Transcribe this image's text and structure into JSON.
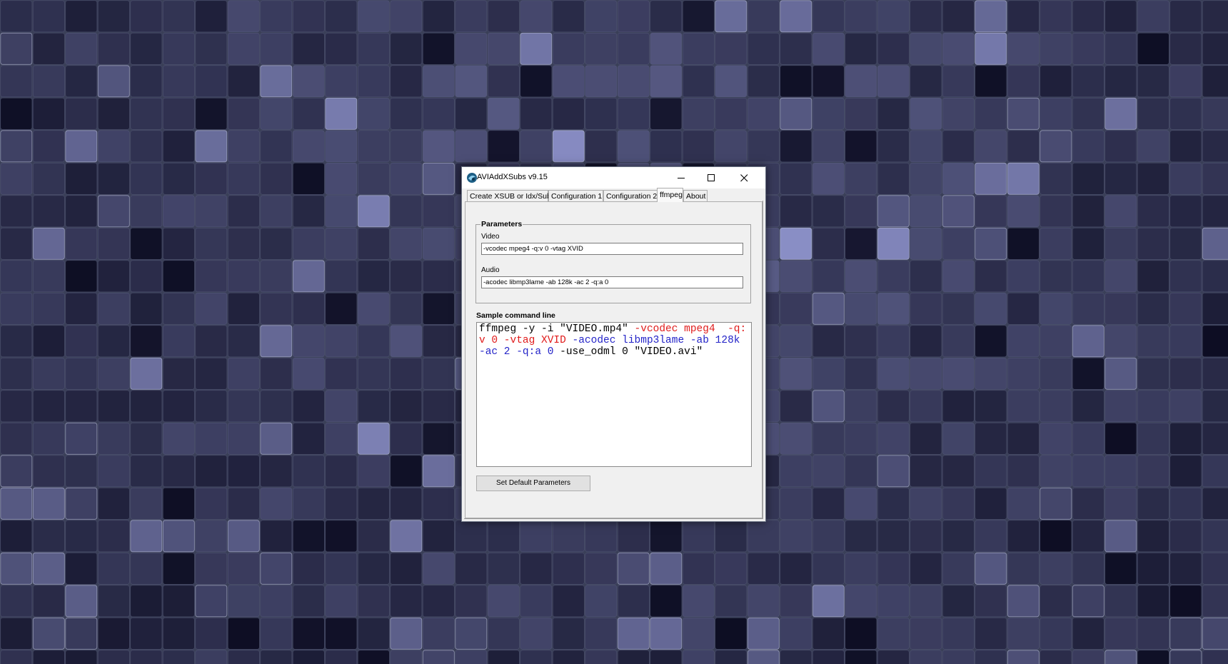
{
  "window": {
    "title": "AVIAddXSubs v9.15"
  },
  "tabs": [
    {
      "label": "Create XSUB or Idx/Sub"
    },
    {
      "label": "Configuration 1"
    },
    {
      "label": "Configuration 2"
    },
    {
      "label": "ffmpeg"
    },
    {
      "label": "About"
    }
  ],
  "active_tab": "ffmpeg",
  "parameters": {
    "group_title": "Parameters",
    "video_label": "Video",
    "video_value": "-vcodec mpeg4  -q:v 0 -vtag XVID",
    "audio_label": "Audio",
    "audio_value": "-acodec libmp3lame -ab 128k -ac 2 -q:a 0"
  },
  "sample": {
    "label": "Sample command line",
    "segments": [
      {
        "text": "ffmpeg -y -i \"VIDEO.mp4\" ",
        "color": "#000000"
      },
      {
        "text": "-vcodec mpeg4  -q:v 0 -vtag XVID ",
        "color": "#e01b1b"
      },
      {
        "text": "-acodec libmp3lame -ab 128k -ac 2 -q:a 0 ",
        "color": "#2424c8"
      },
      {
        "text": "-use_odml 0 \"VIDEO.avi\"",
        "color": "#000000"
      }
    ]
  },
  "buttons": {
    "set_default": "Set Default Parameters"
  },
  "icons": {
    "app": "app-icon",
    "minimize": "minimize-icon",
    "maximize": "maximize-icon",
    "close": "close-icon"
  },
  "colors": {
    "desktop_base": "#3c4159",
    "command_red": "#e01b1b",
    "command_blue": "#2424c8"
  }
}
